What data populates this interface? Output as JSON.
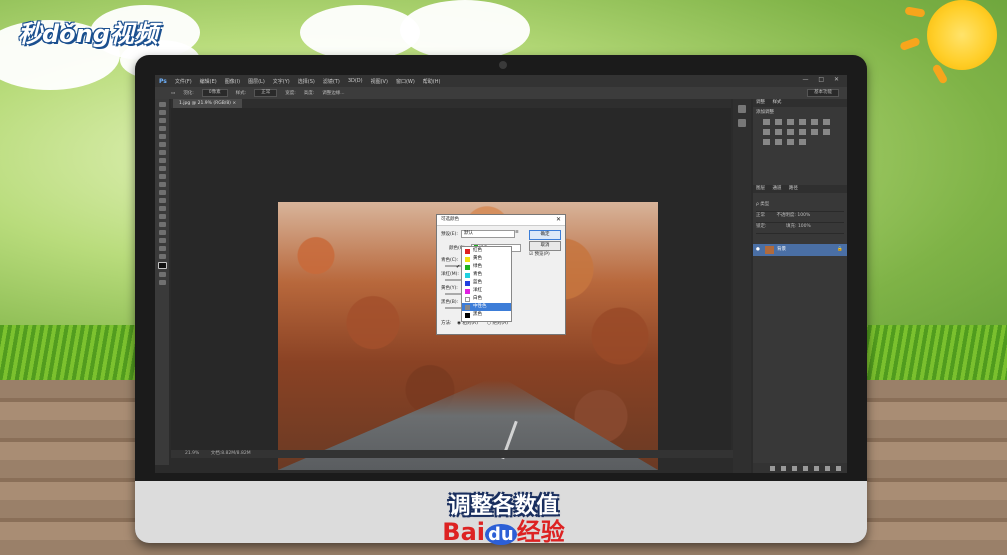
{
  "brand_logo": "秒dǒng视频",
  "photoshop": {
    "app_logo": "Ps",
    "menu": [
      "文件(F)",
      "编辑(E)",
      "图像(I)",
      "图层(L)",
      "文字(Y)",
      "选择(S)",
      "滤镜(T)",
      "3D(D)",
      "视图(V)",
      "窗口(W)",
      "帮助(H)"
    ],
    "window_controls": "— □ ✕",
    "options_bar": {
      "feather_label": "羽化:",
      "feather_value": "0像素",
      "style_label": "样式:",
      "style_value": "正常",
      "width_label": "宽度:",
      "height_label": "高度:",
      "refine_edge": "调整边缘...",
      "workspace": "基本功能"
    },
    "doc_tab": "1.jpg @ 21.9% (RGB/8) ×",
    "status": {
      "zoom": "21.9%",
      "doc_size": "文档:8.82M/8.82M"
    },
    "panels": {
      "top_tabs": [
        "调整",
        "样式"
      ],
      "adjust_title": "添加调整",
      "layer_tabs": [
        "图层",
        "通道",
        "路径"
      ],
      "layer_kind": "ρ 类型",
      "blend_mode": "正常",
      "opacity_label": "不透明度:",
      "opacity_value": "100%",
      "lock_label": "锁定:",
      "fill_label": "填充:",
      "fill_value": "100%",
      "layer_name": "背景"
    },
    "dialog": {
      "title": "可选颜色",
      "preset_label": "预设(E):",
      "preset_value": "默认",
      "colors_label": "颜色(O):",
      "colors_value": "绿色",
      "ok": "确定",
      "cancel": "取消",
      "preview_label": "预览(P)",
      "cyan_label": "青色(C):",
      "magenta_label": "洋红(M):",
      "yellow_label": "黄色(Y):",
      "black_label": "黑色(B):",
      "method_label": "方法:",
      "relative": "相对(R)",
      "absolute": "绝对(A)"
    },
    "dropdown": [
      {
        "label": "红色",
        "color": "#e02020"
      },
      {
        "label": "黄色",
        "color": "#f0e010"
      },
      {
        "label": "绿色",
        "color": "#20b020",
        "checked": true
      },
      {
        "label": "青色",
        "color": "#20d0e0"
      },
      {
        "label": "蓝色",
        "color": "#2040e0"
      },
      {
        "label": "洋红",
        "color": "#e020e0"
      },
      {
        "label": "白色",
        "color": "#ffffff"
      },
      {
        "label": "中性色",
        "color": "#888888",
        "selected": true
      },
      {
        "label": "黑色",
        "color": "#000000"
      }
    ]
  },
  "caption": "调整各数值",
  "watermark": {
    "part1": "Bai",
    "part2": "du",
    "part3": "经验"
  }
}
